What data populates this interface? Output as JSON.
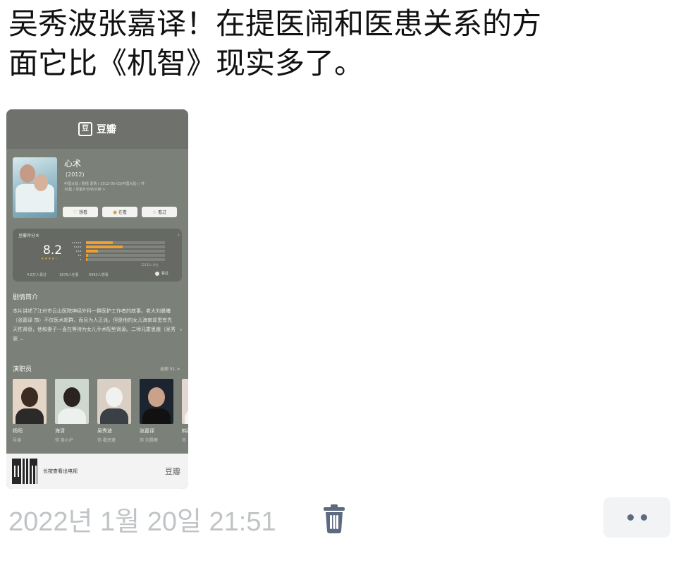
{
  "post": {
    "text_lines": [
      "吴秀波张嘉译！在提医闹和医患关系的方",
      "面它比《机智》现实多了。"
    ],
    "timestamp": "2022년 1월 20일 21:51"
  },
  "card": {
    "header": {
      "logo_glyph": "豆",
      "brand": "豆瓣"
    },
    "movie": {
      "title": "心术",
      "year": "(2012)",
      "meta_line1": "中国大陆 / 剧情 爱情 / 2012-05-03(中国大陆) / 共",
      "meta_line2": "36集 / 单集片长45分钟 >",
      "actions": [
        {
          "icon": "heart-icon",
          "glyph": "♡",
          "label": "想看"
        },
        {
          "icon": "circle-icon",
          "glyph": "◉",
          "label": "在看"
        },
        {
          "icon": "star-icon",
          "glyph": "☆",
          "label": "看过"
        }
      ]
    },
    "rating": {
      "label": "豆瓣评分®",
      "score": "8.2",
      "stars": "★★★★☆",
      "star_labels": [
        "★★★★★",
        "★★★★",
        "★★★",
        "★★",
        "★"
      ],
      "distribution": [
        0.34,
        0.46,
        0.15,
        0.03,
        0.02
      ],
      "count": "12132人评分",
      "wanted": "4.8万人看过",
      "watching": "1876人在看",
      "wish": "6963人想看",
      "watched_label": "看过"
    },
    "synopsis": {
      "heading": "剧情简介",
      "text": "本片讲述了江州市云山医院神经外科一群医护工作者的故事。老大刘晨曦（张嘉译 饰）不仅医术超群，而且为人正派，但是他的女儿海南却患有先天性肾衰，他和妻子一直在等待为女儿手术配型肾源。二师兄霍思邈（吴秀波 ..."
    },
    "cast": {
      "heading": "演职员",
      "all_link": "全部 51 >",
      "members": [
        {
          "name": "杨阳",
          "role": "导演"
        },
        {
          "name": "海清",
          "role": "饰 美小护"
        },
        {
          "name": "吴秀波",
          "role": "饰 霍思邈"
        },
        {
          "name": "张嘉译",
          "role": "饰 刘晨曦"
        },
        {
          "name": "韩雨",
          "role": "饰"
        }
      ]
    },
    "footer": {
      "text": "长按查看出电视",
      "brand": "豆瓣"
    }
  },
  "colors": {
    "card_bg": "#7b8079",
    "rating_bar": "#efa030",
    "timestamp": "#c1c4c6",
    "more_dots": "#5d6b80"
  }
}
